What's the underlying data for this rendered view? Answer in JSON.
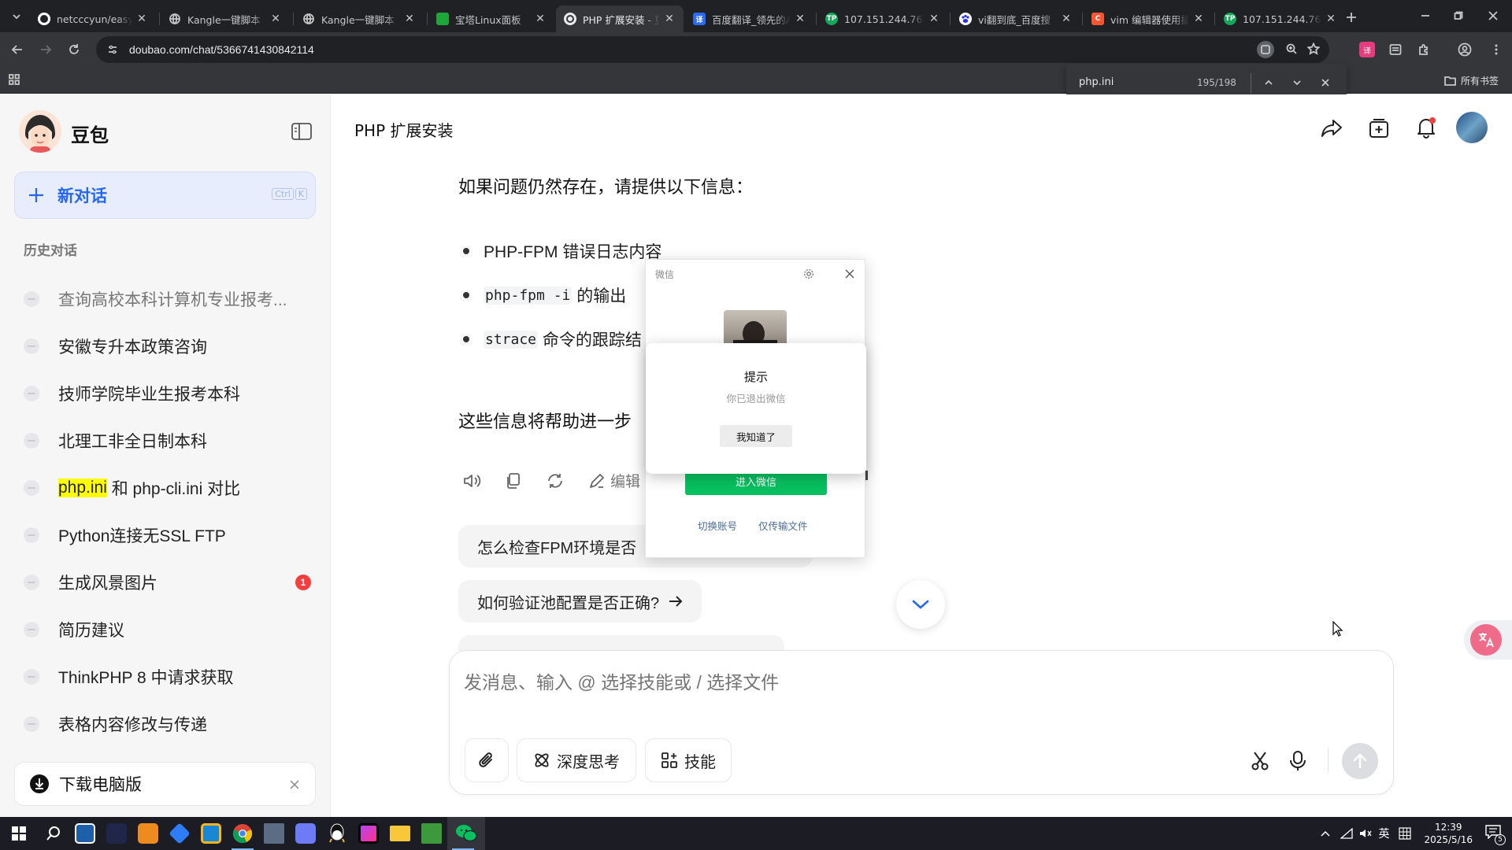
{
  "browser": {
    "tabs": [
      {
        "title": "netcccyun/easyp",
        "fav": "github-icon"
      },
      {
        "title": "Kangle一键脚本",
        "fav": "globe-icon"
      },
      {
        "title": "Kangle一键脚本",
        "fav": "globe-icon"
      },
      {
        "title": "宝塔Linux面板",
        "fav": "shield-icon"
      },
      {
        "title": "PHP 扩展安装 - 豆",
        "fav": "doubao-icon",
        "active": true
      },
      {
        "title": "百度翻译_领先的A",
        "fav": "baidu-translate-icon"
      },
      {
        "title": "107.151.244.76:8",
        "fav": "tp-icon"
      },
      {
        "title": "vi翻到底_百度搜",
        "fav": "baidu-icon"
      },
      {
        "title": "vim 编辑器使用插",
        "fav": "csdn-icon"
      },
      {
        "title": "107.151.244.76:8",
        "fav": "tp-icon"
      }
    ],
    "url": "doubao.com/chat/5366741430842114",
    "bookmarks_label": "所有书签",
    "find": {
      "query": "php.ini",
      "count": "195/198"
    }
  },
  "sidebar": {
    "brand": "豆包",
    "new_chat": "新对话",
    "shortcut": [
      "Ctrl",
      "K"
    ],
    "history_title": "历史对话",
    "items": [
      {
        "label": "查询高校本科计算机专业报考...",
        "faded": true
      },
      {
        "label": "安徽专升本政策咨询"
      },
      {
        "label": "技师学院毕业生报考本科"
      },
      {
        "label": "北理工非全日制本科"
      },
      {
        "label_hl": "php.ini",
        "label": " 和 php-cli.ini 对比"
      },
      {
        "label": "Python连接无SSL FTP"
      },
      {
        "label": "生成风景图片",
        "badge": "1"
      },
      {
        "label": "简历建议"
      },
      {
        "label": "ThinkPHP 8 中请求获取"
      },
      {
        "label": "表格内容修改与传递"
      }
    ],
    "download": "下载电脑版"
  },
  "chat": {
    "title": "PHP 扩展安装",
    "intro": "如果问题仍然存在，请提供以下信息：",
    "bullets": [
      {
        "text": "PHP-FPM 错误日志内容"
      },
      {
        "code": "php-fpm -i",
        "text": " 的输出"
      },
      {
        "code": "strace",
        "text": " 命令的跟踪结"
      }
    ],
    "closing": "这些信息将帮助进一步",
    "actions": {
      "edit": "编辑"
    },
    "suggestions": [
      "怎么检查FPM环境是否",
      "如何验证池配置是否正确?"
    ],
    "input_placeholder": "发消息、输入 @ 选择技能或 / 选择文件",
    "deep_think": "深度思考",
    "skills": "技能"
  },
  "wechat": {
    "title": "微信",
    "enter": "进入微信",
    "switch": "切换账号",
    "transfer": "仅传输文件",
    "dialog": {
      "title": "提示",
      "message": "你已退出微信",
      "ok": "我知道了"
    }
  },
  "taskbar": {
    "lang": "英",
    "time": "12:39",
    "date": "2025/5/16",
    "notifications": "5"
  },
  "colors": {
    "accent": "#2566f6",
    "new_chat_bg": "#e7edfd",
    "badge": "#f53f3f",
    "wechat_green": "#07c160",
    "highlight": "#ffff00"
  }
}
